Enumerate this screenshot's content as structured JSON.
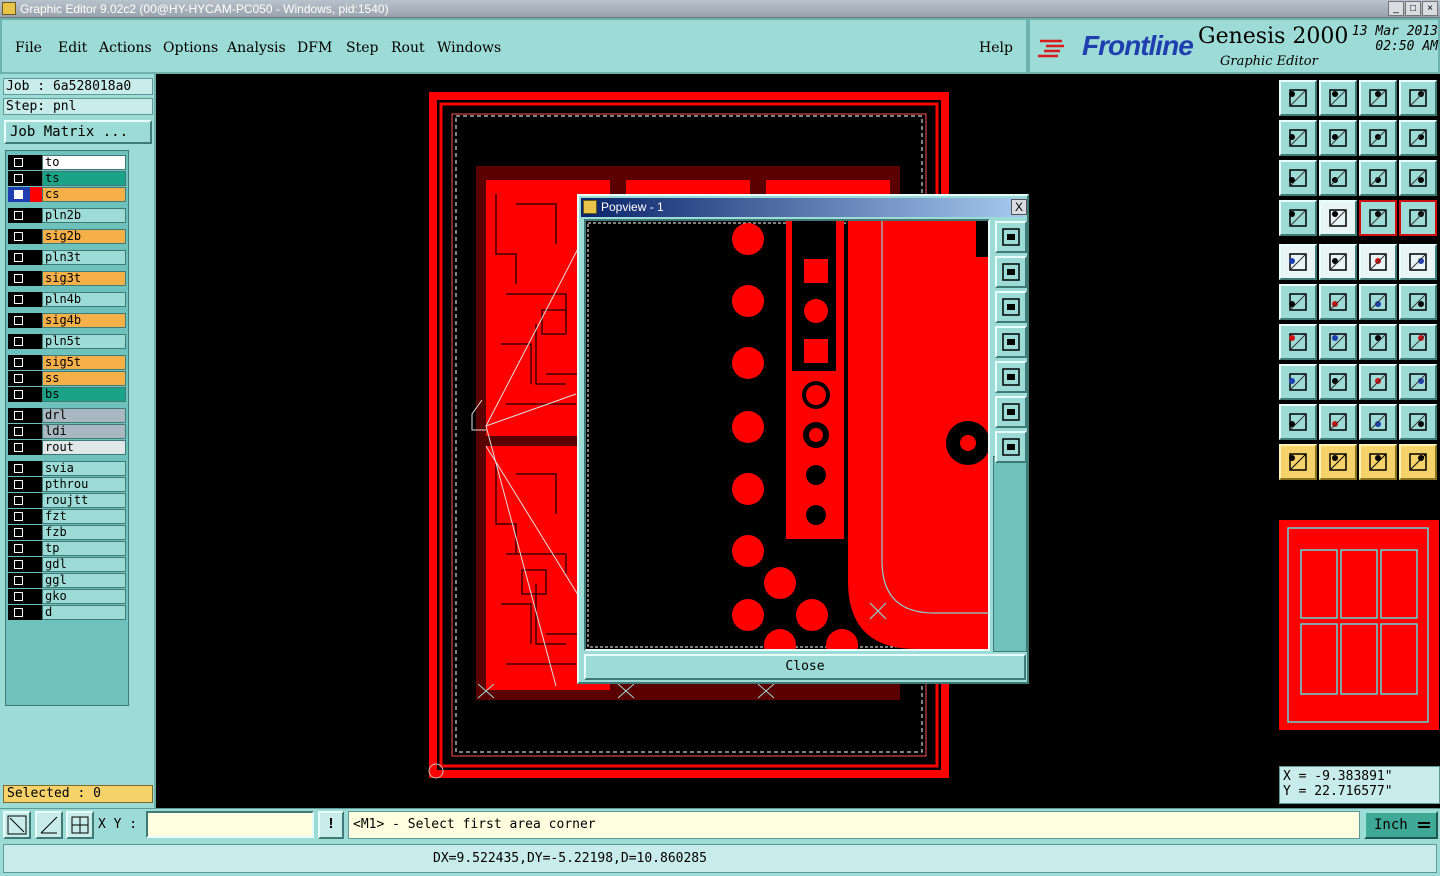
{
  "window": {
    "title": "Graphic Editor 9.02c2 (00@HY-HYCAM-PC050 - Windows, pid:1540)"
  },
  "menu": [
    "File",
    "Edit",
    "Actions",
    "Options",
    "Analysis",
    "DFM",
    "Step",
    "Rout",
    "Windows"
  ],
  "help_label": "Help",
  "brand": {
    "logo": "Frontline",
    "product": "Genesis 2000",
    "subtitle": "Graphic Editor",
    "date": "13 Mar 2013",
    "time": "02:50 AM"
  },
  "job": {
    "job_line": "Job : 6a528018a0",
    "step_line": "Step: pnl",
    "matrix_button": "Job Matrix ..."
  },
  "layers": [
    {
      "name": "to",
      "color": "#ffffff"
    },
    {
      "name": "ts",
      "color": "#1aa386"
    },
    {
      "name": "cs",
      "color": "#f6b04a",
      "active": true
    },
    {
      "name": "pln2b",
      "color": "#9ddbd6"
    },
    {
      "name": "sig2b",
      "color": "#f6b04a"
    },
    {
      "name": "pln3t",
      "color": "#9ddbd6"
    },
    {
      "name": "sig3t",
      "color": "#f6b04a"
    },
    {
      "name": "pln4b",
      "color": "#9ddbd6"
    },
    {
      "name": "sig4b",
      "color": "#f6b04a"
    },
    {
      "name": "pln5t",
      "color": "#9ddbd6"
    },
    {
      "name": "sig5t",
      "color": "#f6b04a"
    },
    {
      "name": "ss",
      "color": "#f6b04a"
    },
    {
      "name": "bs",
      "color": "#1aa386"
    },
    {
      "name": "drl",
      "color": "#a9b7c1"
    },
    {
      "name": "ldi",
      "color": "#a9b7c1"
    },
    {
      "name": "rout",
      "color": "#dfe7e9"
    },
    {
      "name": "svia",
      "color": "#9ddbd6"
    },
    {
      "name": "pthrou",
      "color": "#9ddbd6"
    },
    {
      "name": "roujtt",
      "color": "#9ddbd6"
    },
    {
      "name": "fzt",
      "color": "#9ddbd6"
    },
    {
      "name": "fzb",
      "color": "#9ddbd6"
    },
    {
      "name": "tp",
      "color": "#9ddbd6"
    },
    {
      "name": "gdl",
      "color": "#9ddbd6"
    },
    {
      "name": "ggl",
      "color": "#9ddbd6"
    },
    {
      "name": "gko",
      "color": "#9ddbd6"
    },
    {
      "name": "d",
      "color": "#9ddbd6"
    }
  ],
  "selected_text": "Selected : 0",
  "popview": {
    "title": "Popview - 1",
    "close_button": "Close",
    "close_x": "X"
  },
  "coords": {
    "x": "X = -9.383891\"",
    "y": "Y = 22.716577\""
  },
  "bottom": {
    "xy_label": "X Y :",
    "xy_value": "",
    "excl": "!",
    "prompt": "<M1> - Select first area corner",
    "units": "Inch",
    "status": "DX=9.522435,DY=-5.22198,D=10.860285"
  },
  "colors": {
    "panel": "#9ddbd6",
    "board_red": "#ff0000",
    "accent_yellow": "#f6d26a"
  }
}
